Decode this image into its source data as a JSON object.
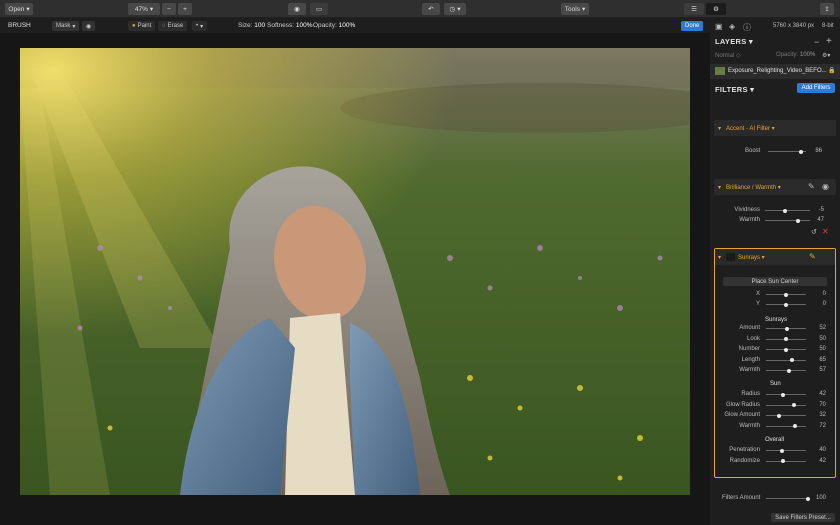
{
  "toolbar": {
    "open": "Open",
    "zoom": "47%",
    "tools": "Tools"
  },
  "brushbar": {
    "title": "BRUSH",
    "mask": "Mask",
    "paint": "Paint",
    "erase": "Erase",
    "size_label": "Size:",
    "size": "100",
    "softness_label": "Softness:",
    "softness": "100%",
    "opacity_label": "Opacity:",
    "opacity": "100%",
    "done": "Done"
  },
  "panel": {
    "image_size": "5760 x 3840 px",
    "bit_depth": "8-bit",
    "layers_title": "LAYERS",
    "blend_mode": "Normal",
    "opacity_label": "Opacity:",
    "opacity_val": "100%",
    "layer_name": "Exposure_Relighting_Video_BEFO...",
    "filters_title": "FILTERS",
    "add_filters": "Add Filters",
    "accent": {
      "title": "Accent - AI Filter",
      "boost_label": "Boost",
      "boost": "86",
      "boost_frac": 0.86
    },
    "brilliance": {
      "title": "Brilliance / Warmth",
      "rows": [
        {
          "label": "Vividness",
          "value": "-5",
          "frac": 0.45
        },
        {
          "label": "Warmth",
          "value": "47",
          "frac": 0.73
        }
      ]
    },
    "sunrays": {
      "title": "Sunrays",
      "place_btn": "Place Sun Center",
      "xy": [
        {
          "label": "X",
          "value": "0",
          "frac": 0.5
        },
        {
          "label": "Y",
          "value": "0",
          "frac": 0.5
        }
      ],
      "group1": "Sunrays",
      "rows1": [
        {
          "label": "Amount",
          "value": "52",
          "frac": 0.52
        },
        {
          "label": "Look",
          "value": "50",
          "frac": 0.5
        },
        {
          "label": "Number",
          "value": "50",
          "frac": 0.5
        },
        {
          "label": "Length",
          "value": "65",
          "frac": 0.65
        },
        {
          "label": "Warmth",
          "value": "57",
          "frac": 0.57
        }
      ],
      "group2": "Sun",
      "rows2": [
        {
          "label": "Radius",
          "value": "42",
          "frac": 0.42
        },
        {
          "label": "Glow Radius",
          "value": "70",
          "frac": 0.7
        },
        {
          "label": "Glow Amount",
          "value": "32",
          "frac": 0.32
        },
        {
          "label": "Warmth",
          "value": "72",
          "frac": 0.72
        }
      ],
      "group3": "Overall",
      "rows3": [
        {
          "label": "Penetration",
          "value": "40",
          "frac": 0.4
        },
        {
          "label": "Randomize",
          "value": "42",
          "frac": 0.42
        }
      ]
    },
    "filters_amount_label": "Filters Amount",
    "filters_amount": "100",
    "filters_amount_frac": 1.0,
    "save_preset": "Save Filters Preset..."
  }
}
